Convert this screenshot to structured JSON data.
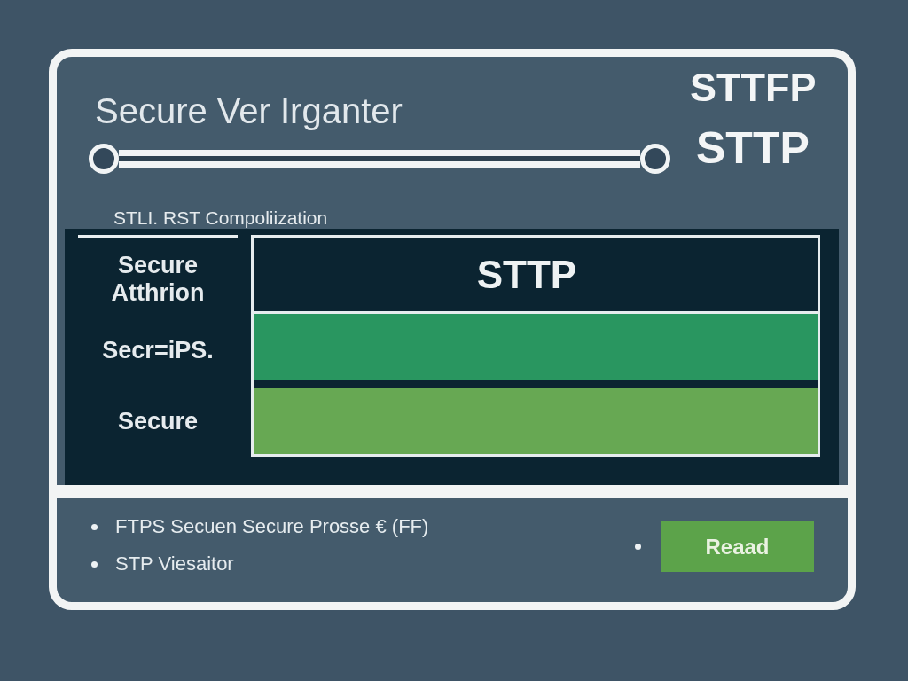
{
  "window": {
    "title": "Secure Ver Irganter"
  },
  "header_labels": [
    "STTFP",
    "STTP"
  ],
  "slider": {
    "level": 1
  },
  "subtitle": "STLI. RST Compoliization",
  "sidebar": {
    "items": [
      "Secure Atthrion",
      "Secr=iPS.",
      "Secure"
    ]
  },
  "panel": {
    "title": "STTP",
    "rows": [
      {
        "color": "#299660"
      },
      {
        "color": "#67a853"
      }
    ]
  },
  "bullets": [
    "FTPS Secuen Secure Prosse € (FF)",
    "STP Viesaitor"
  ],
  "button": {
    "label": "Reaad"
  }
}
